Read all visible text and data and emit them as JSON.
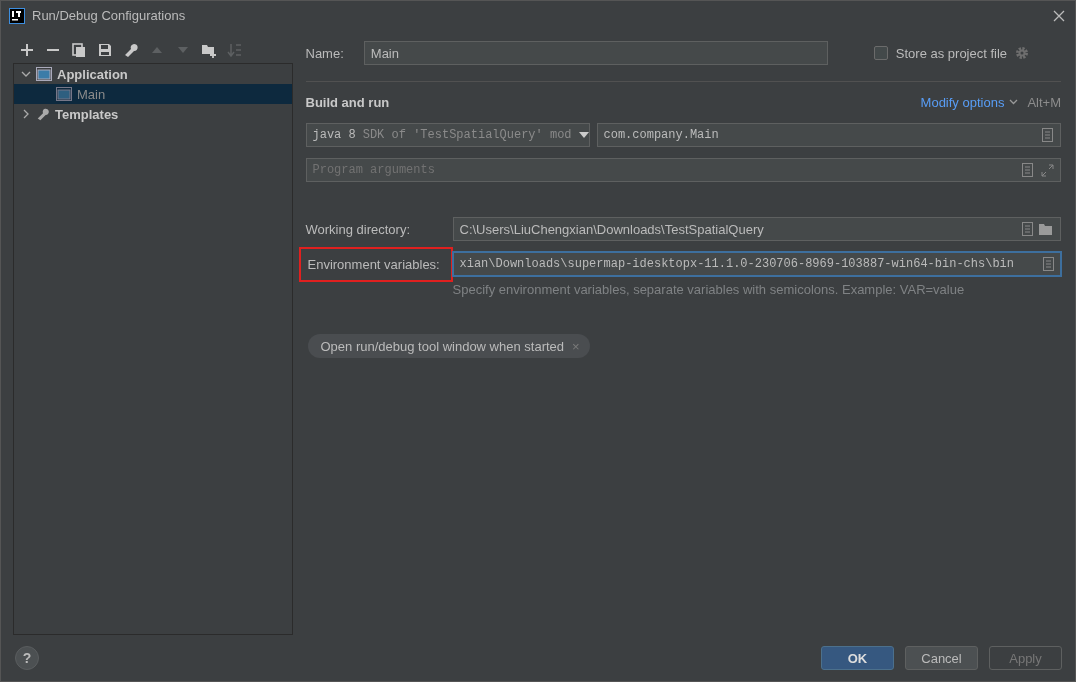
{
  "window": {
    "title": "Run/Debug Configurations"
  },
  "toolbar": [
    {
      "kind": "plus",
      "disabled": false
    },
    {
      "kind": "minus",
      "disabled": false
    },
    {
      "kind": "copy",
      "disabled": false
    },
    {
      "kind": "save",
      "disabled": false
    },
    {
      "kind": "wrench",
      "disabled": false
    },
    {
      "kind": "up",
      "disabled": true
    },
    {
      "kind": "down",
      "disabled": true
    },
    {
      "kind": "folder",
      "disabled": false
    },
    {
      "kind": "sort",
      "disabled": true
    }
  ],
  "tree": [
    {
      "label": "Application",
      "kind": "app",
      "expanded": true,
      "selected": false,
      "children": [
        {
          "label": "Main",
          "kind": "app",
          "selected": true
        }
      ]
    },
    {
      "label": "Templates",
      "kind": "wrench",
      "expanded": false,
      "selected": false
    }
  ],
  "name": {
    "label": "Name:",
    "value": "Main"
  },
  "store": {
    "label": "Store as project file",
    "checked": false
  },
  "section": {
    "title": "Build and run",
    "modify": "Modify options",
    "shortcut": "Alt+M"
  },
  "sdk": {
    "value": "java 8",
    "detail": "SDK of 'TestSpatialQuery' mod"
  },
  "main_class": {
    "value": "com.company.Main"
  },
  "program_arguments": {
    "placeholder": "Program arguments"
  },
  "working_directory": {
    "label": "Working directory:",
    "value": "C:\\Users\\LiuChengxian\\Downloads\\TestSpatialQuery"
  },
  "environment": {
    "label": "Environment variables:",
    "highlighted": true,
    "value": "xian\\Downloads\\supermap-idesktopx-11.1.0-230706-8969-103887-win64-bin-chs\\bin",
    "focused": true,
    "hint": "Specify environment variables, separate variables with semicolons. Example: VAR=value"
  },
  "chips": [
    {
      "label": "Open run/debug tool window when started",
      "close": "×"
    }
  ],
  "help": "?",
  "buttons": [
    {
      "label": "OK",
      "default": true,
      "disabled": false
    },
    {
      "label": "Cancel",
      "default": false,
      "disabled": false
    },
    {
      "label": "Apply",
      "default": false,
      "disabled": true
    }
  ]
}
